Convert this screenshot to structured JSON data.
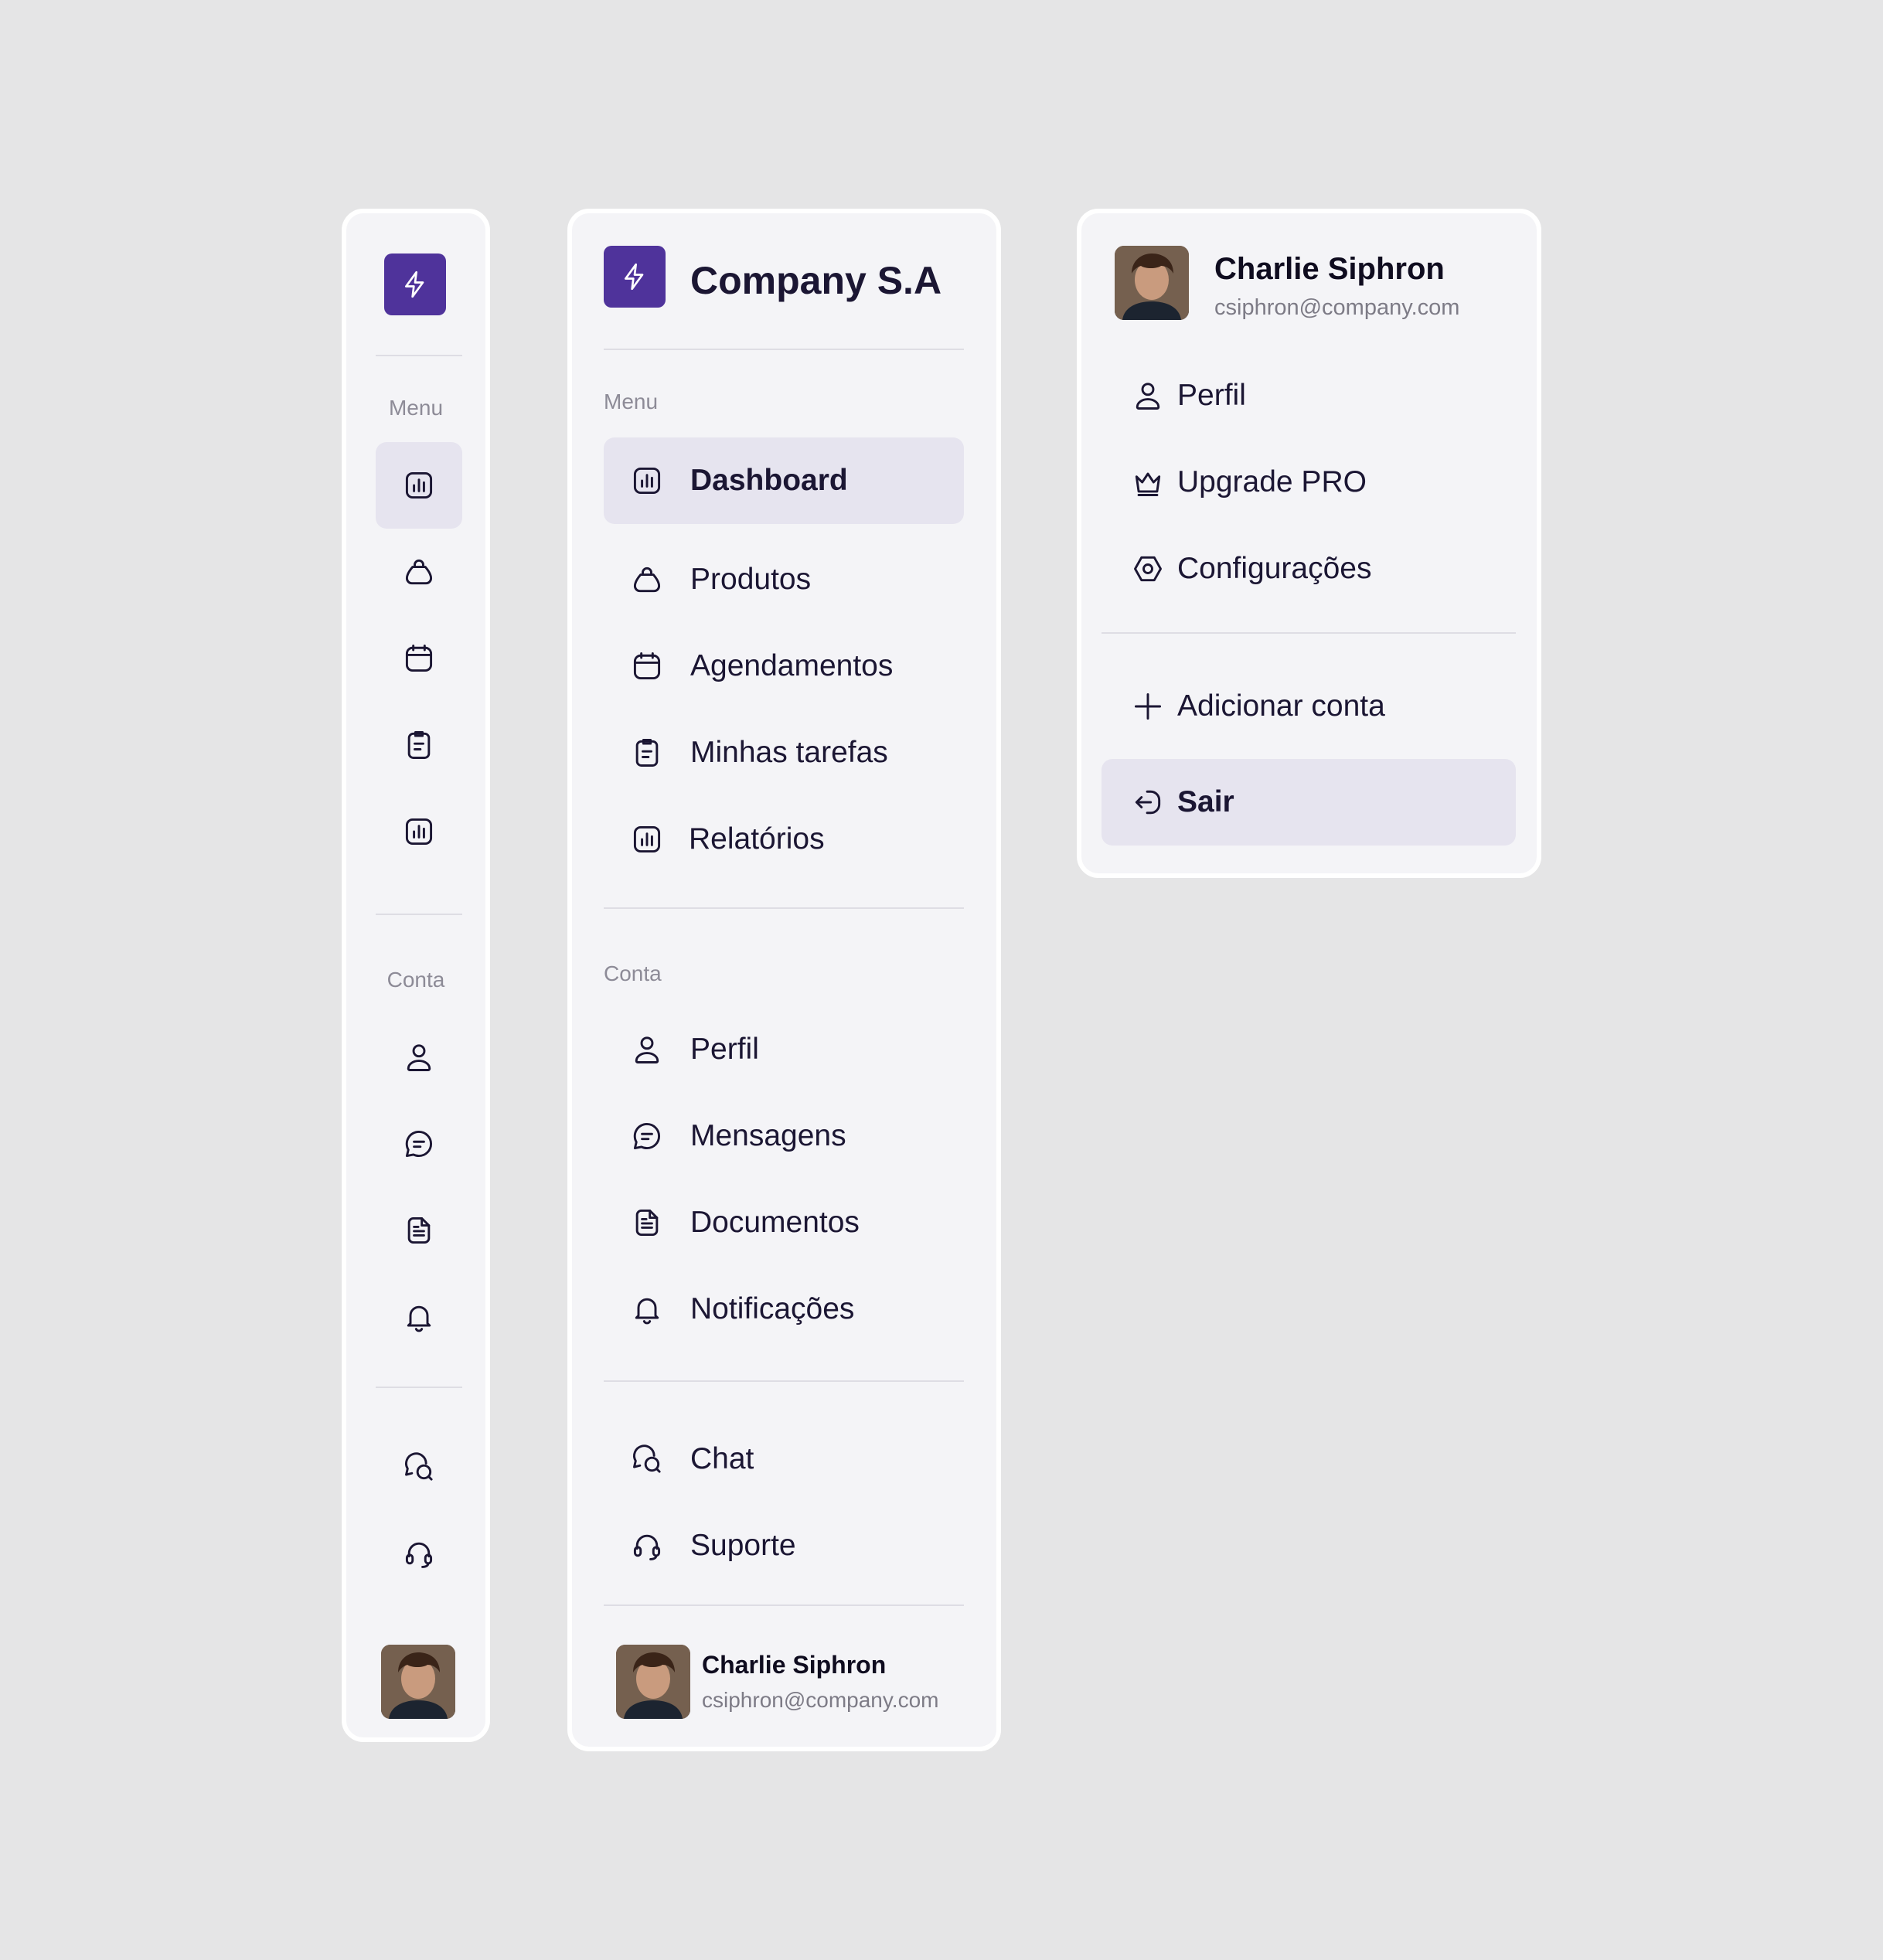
{
  "brand": {
    "name": "Company S.A",
    "logo_icon": "lightning-bolt-icon",
    "accent_color": "#4f339b"
  },
  "sections": {
    "menu_label": "Menu",
    "account_label": "Conta"
  },
  "menu_items": [
    {
      "label": "Dashboard",
      "icon": "bar-chart-icon",
      "active": true
    },
    {
      "label": "Produtos",
      "icon": "shopping-bag-icon",
      "active": false
    },
    {
      "label": "Agendamentos",
      "icon": "calendar-icon",
      "active": false
    },
    {
      "label": "Minhas tarefas",
      "icon": "clipboard-icon",
      "active": false
    },
    {
      "label": "Relatórios",
      "icon": "report-chart-icon",
      "active": false
    }
  ],
  "account_items": [
    {
      "label": "Perfil",
      "icon": "user-icon"
    },
    {
      "label": "Mensagens",
      "icon": "message-icon"
    },
    {
      "label": "Documentos",
      "icon": "document-icon"
    },
    {
      "label": "Notificações",
      "icon": "bell-icon"
    }
  ],
  "support_items": [
    {
      "label": "Chat",
      "icon": "chat-icon"
    },
    {
      "label": "Suporte",
      "icon": "headset-icon"
    }
  ],
  "user": {
    "name": "Charlie Siphron",
    "email": "csiphron@company.com"
  },
  "dropdown": {
    "items": [
      {
        "label": "Perfil",
        "icon": "user-icon"
      },
      {
        "label": "Upgrade PRO",
        "icon": "crown-icon"
      },
      {
        "label": "Configurações",
        "icon": "settings-icon"
      }
    ],
    "add_account": {
      "label": "Adicionar conta",
      "icon": "plus-icon"
    },
    "logout": {
      "label": "Sair",
      "icon": "logout-icon",
      "active": true
    }
  }
}
